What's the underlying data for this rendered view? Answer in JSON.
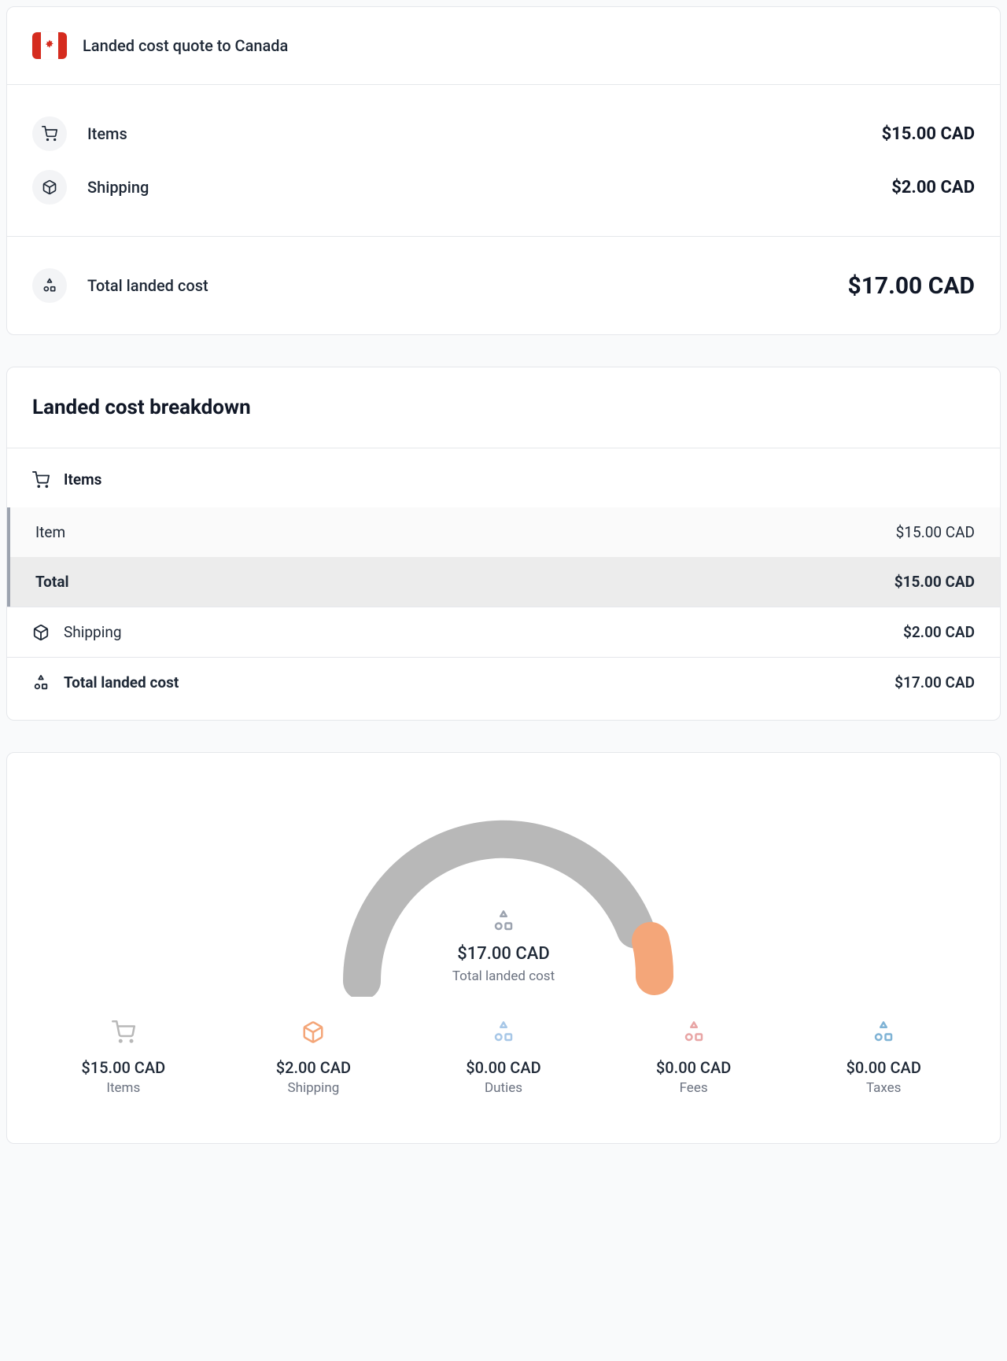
{
  "quote": {
    "title": "Landed cost quote to Canada",
    "items_label": "Items",
    "items_value": "$15.00 CAD",
    "shipping_label": "Shipping",
    "shipping_value": "$2.00 CAD",
    "total_label": "Total landed cost",
    "total_value": "$17.00 CAD"
  },
  "breakdown": {
    "title": "Landed cost breakdown",
    "items_head": "Items",
    "item_row_label": "Item",
    "item_row_value": "$15.00 CAD",
    "total_row_label": "Total",
    "total_row_value": "$15.00 CAD",
    "shipping_label": "Shipping",
    "shipping_value": "$2.00 CAD",
    "landed_label": "Total landed cost",
    "landed_value": "$17.00 CAD"
  },
  "chart": {
    "center_value": "$17.00 CAD",
    "center_label": "Total landed cost",
    "legend": {
      "items_value": "$15.00 CAD",
      "items_label": "Items",
      "shipping_value": "$2.00 CAD",
      "shipping_label": "Shipping",
      "duties_value": "$0.00 CAD",
      "duties_label": "Duties",
      "fees_value": "$0.00 CAD",
      "fees_label": "Fees",
      "taxes_value": "$0.00 CAD",
      "taxes_label": "Taxes"
    },
    "colors": {
      "items": "#b8b8b8",
      "shipping": "#f4a679",
      "duties": "#a7c7e7",
      "fees": "#e8a5a5",
      "taxes": "#7fb3d5"
    }
  },
  "chart_data": {
    "type": "pie",
    "title": "Total landed cost",
    "series": [
      {
        "name": "Items",
        "value": 15.0
      },
      {
        "name": "Shipping",
        "value": 2.0
      },
      {
        "name": "Duties",
        "value": 0.0
      },
      {
        "name": "Fees",
        "value": 0.0
      },
      {
        "name": "Taxes",
        "value": 0.0
      }
    ],
    "currency": "CAD",
    "total": 17.0
  }
}
